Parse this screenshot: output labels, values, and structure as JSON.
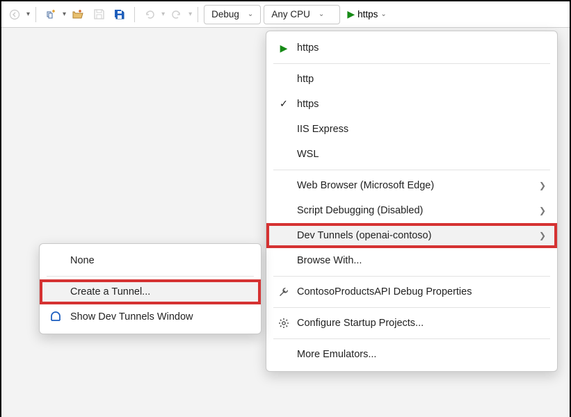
{
  "toolbar": {
    "debug_combo": "Debug",
    "platform_combo": "Any CPU",
    "run_label": "https"
  },
  "dropdown": {
    "https_top": "https",
    "http": "http",
    "https_checked": "https",
    "iis": "IIS Express",
    "wsl": "WSL",
    "browser": "Web Browser (Microsoft Edge)",
    "script_debug": "Script Debugging (Disabled)",
    "dev_tunnels": "Dev Tunnels (openai-contoso)",
    "browse_with": "Browse With...",
    "debug_props": "ContosoProductsAPI Debug Properties",
    "configure_startup": "Configure Startup Projects...",
    "more_emulators": "More Emulators..."
  },
  "submenu": {
    "none": "None",
    "create": "Create a Tunnel...",
    "show_window": "Show Dev Tunnels Window"
  }
}
